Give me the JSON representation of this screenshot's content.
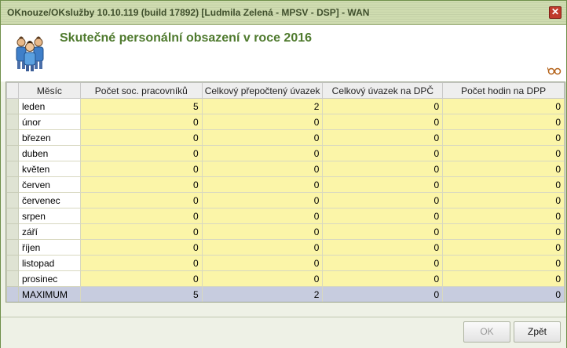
{
  "window": {
    "title": "OKnouze/OKslužby 10.10.119 (build 17892)  [Ludmila Zelená - MPSV - DSP] - WAN",
    "close_glyph": "✕"
  },
  "header": {
    "title": "Skutečné personální obsazení v roce 2016",
    "icon": "people-group-icon",
    "secondary_icon": "glasses-icon"
  },
  "grid": {
    "columns": [
      "Měsíc",
      "Počet soc. pracovníků",
      "Celkový přepočtený úvazek",
      "Celkový úvazek na DPČ",
      "Počet hodin na DPP"
    ],
    "rows": [
      {
        "month": "leden",
        "v1": "5",
        "v2": "2",
        "v3": "0",
        "v4": "0"
      },
      {
        "month": "únor",
        "v1": "0",
        "v2": "0",
        "v3": "0",
        "v4": "0"
      },
      {
        "month": "březen",
        "v1": "0",
        "v2": "0",
        "v3": "0",
        "v4": "0"
      },
      {
        "month": "duben",
        "v1": "0",
        "v2": "0",
        "v3": "0",
        "v4": "0"
      },
      {
        "month": "květen",
        "v1": "0",
        "v2": "0",
        "v3": "0",
        "v4": "0"
      },
      {
        "month": "červen",
        "v1": "0",
        "v2": "0",
        "v3": "0",
        "v4": "0"
      },
      {
        "month": "červenec",
        "v1": "0",
        "v2": "0",
        "v3": "0",
        "v4": "0"
      },
      {
        "month": "srpen",
        "v1": "0",
        "v2": "0",
        "v3": "0",
        "v4": "0"
      },
      {
        "month": "září",
        "v1": "0",
        "v2": "0",
        "v3": "0",
        "v4": "0"
      },
      {
        "month": "říjen",
        "v1": "0",
        "v2": "0",
        "v3": "0",
        "v4": "0"
      },
      {
        "month": "listopad",
        "v1": "0",
        "v2": "0",
        "v3": "0",
        "v4": "0"
      },
      {
        "month": "prosinec",
        "v1": "0",
        "v2": "0",
        "v3": "0",
        "v4": "0"
      }
    ],
    "summary": {
      "month": "MAXIMUM",
      "v1": "5",
      "v2": "2",
      "v3": "0",
      "v4": "0"
    }
  },
  "footer": {
    "ok_label": "OK",
    "back_label": "Zpět"
  },
  "colors": {
    "accent": "#4f7a2e",
    "editable_cell": "#fbf5a8",
    "summary_row": "#c7ccdf"
  }
}
